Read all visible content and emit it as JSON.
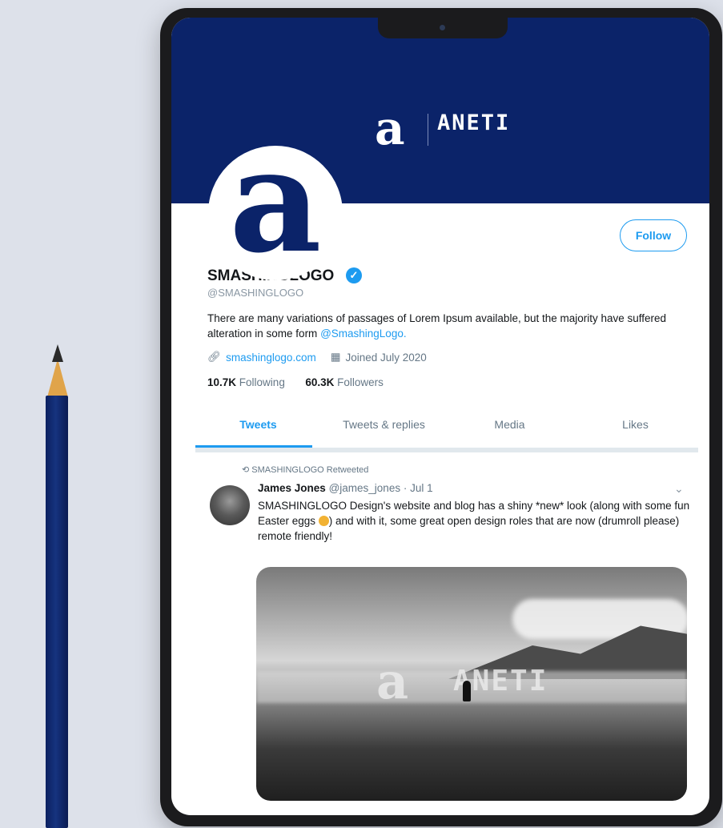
{
  "banner": {
    "brand": "ANETI",
    "mark": "a"
  },
  "avatar": {
    "mark": "a"
  },
  "profile": {
    "follow_label": "Follow",
    "name": "SMASHINGLOGO",
    "handle": "@SMASHINGLOGO",
    "bio_text": "There are many variations of passages of Lorem Ipsum available, but the majority have suffered alteration in some form ",
    "bio_link": "@SmashingLogo.",
    "website": "smashinglogo.com",
    "joined": "Joined July 2020",
    "following_count": "10.7K",
    "following_label": "Following",
    "followers_count": "60.3K",
    "followers_label": "Followers"
  },
  "tabs": [
    "Tweets",
    "Tweets & replies",
    "Media",
    "Likes"
  ],
  "tweet": {
    "retweeted_by": "SMASHINGLOGO Retweeted",
    "author": "James Jones",
    "author_handle": "@james_jones",
    "date": "· Jul 1",
    "text_part1": "SMASHINGLOGO Design's website and blog has a shiny *new* look (along with some fun Easter eggs ",
    "text_part2": ") and with it, some great open design roles that are now (drumroll please) remote friendly!",
    "image_brand": "ANETI",
    "image_mark": "a"
  },
  "icons": {
    "verified": "verified-check-icon",
    "link": "link-icon",
    "calendar": "calendar-icon",
    "retweet": "retweet-icon",
    "chevron": "chevron-down-icon"
  },
  "colors": {
    "brand_navy": "#0b2369",
    "accent_blue": "#1d9bf0"
  }
}
